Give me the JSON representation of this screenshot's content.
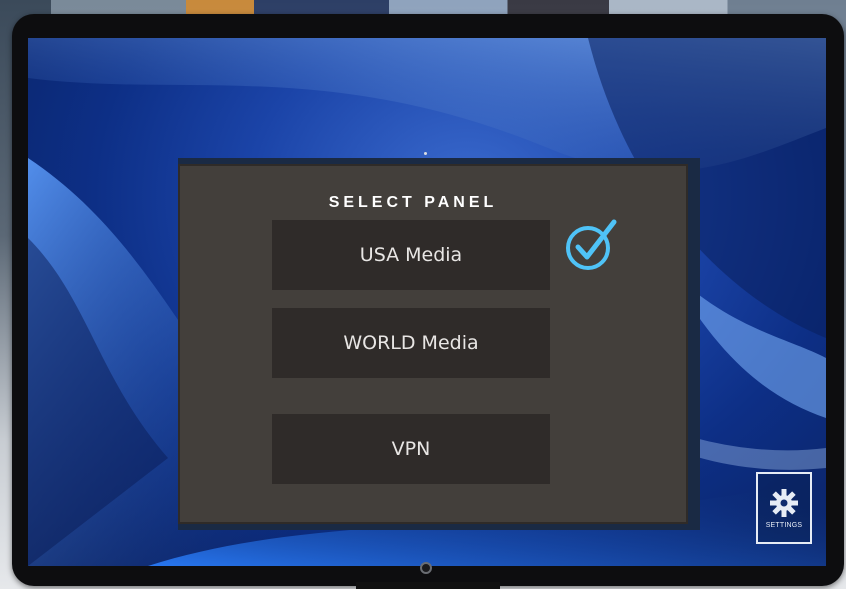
{
  "panel": {
    "title": "SELECT PANEL",
    "options": [
      {
        "label": "USA Media",
        "selected": true
      },
      {
        "label": "WORLD Media",
        "selected": false
      },
      {
        "label": "VPN",
        "selected": false
      }
    ]
  },
  "settings": {
    "label": "SETTINGS",
    "icon": "gear-icon"
  },
  "icons": {
    "selected_indicator": "checkmark-circle-icon"
  },
  "colors": {
    "accent": "#4fc3f7",
    "panel_bg": "#433f3b",
    "button_bg": "#2f2b29",
    "screen_blue": "#1b44a8"
  }
}
